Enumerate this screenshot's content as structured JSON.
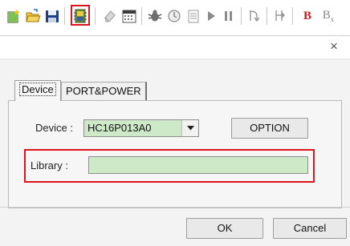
{
  "toolbar": {
    "icons": [
      "new-file-icon",
      "open-folder-icon",
      "save-icon",
      "chip-device-icon",
      "eraser-icon",
      "calendar-icon",
      "debug-bug-icon",
      "clock-icon",
      "list-icon",
      "run-icon",
      "pause-icon",
      "step-into-icon",
      "step-over-icon",
      "bold-breakpoint-icon",
      "clear-breakpoint-icon"
    ],
    "bold_label": "B",
    "bx_label": "B",
    "bx_sub": "x"
  },
  "dialog": {
    "close_label": "×",
    "tabs": [
      {
        "label": "Device"
      },
      {
        "label": "PORT&POWER"
      }
    ],
    "device_label": "Device :",
    "device_value": "HC16P013A0",
    "option_label": "OPTION",
    "library_label": "Library :",
    "library_value": "",
    "ok_label": "OK",
    "cancel_label": "Cancel"
  },
  "colors": {
    "highlight": "#e0121d",
    "input_green": "#cde9c7"
  }
}
